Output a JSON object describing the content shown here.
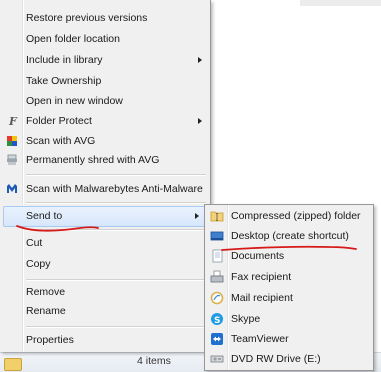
{
  "context_menu": {
    "items": [
      {
        "label": "Restore previous versions",
        "icon": null,
        "submenu": false
      },
      {
        "label": "Open folder location",
        "icon": null,
        "submenu": false
      },
      {
        "label": "Include in library",
        "icon": null,
        "submenu": true
      },
      {
        "label": "Take Ownership",
        "icon": null,
        "submenu": false
      },
      {
        "label": "Open in new window",
        "icon": null,
        "submenu": false
      },
      {
        "label": "Folder Protect",
        "icon": "folder-protect-icon",
        "submenu": true
      },
      {
        "label": "Scan with AVG",
        "icon": "avg-icon",
        "submenu": false
      },
      {
        "label": "Permanently shred with AVG",
        "icon": "shredder-icon",
        "submenu": false
      },
      {
        "label": "Scan with Malwarebytes Anti-Malware",
        "icon": "malwarebytes-icon",
        "submenu": false
      },
      {
        "label": "Send to",
        "icon": null,
        "submenu": true,
        "highlighted": true
      },
      {
        "label": "Cut",
        "icon": null,
        "submenu": false
      },
      {
        "label": "Copy",
        "icon": null,
        "submenu": false
      },
      {
        "label": "Remove",
        "icon": null,
        "submenu": false
      },
      {
        "label": "Rename",
        "icon": null,
        "submenu": false
      },
      {
        "label": "Properties",
        "icon": null,
        "submenu": false
      }
    ]
  },
  "send_to_menu": {
    "items": [
      {
        "label": "Compressed (zipped) folder",
        "icon": "zip-folder-icon"
      },
      {
        "label": "Desktop (create shortcut)",
        "icon": "desktop-icon"
      },
      {
        "label": "Documents",
        "icon": "documents-icon"
      },
      {
        "label": "Fax recipient",
        "icon": "fax-icon"
      },
      {
        "label": "Mail recipient",
        "icon": "mail-icon"
      },
      {
        "label": "Skype",
        "icon": "skype-icon"
      },
      {
        "label": "TeamViewer",
        "icon": "teamviewer-icon"
      },
      {
        "label": "DVD RW Drive (E:)",
        "icon": "dvd-drive-icon"
      }
    ]
  },
  "status_bar": {
    "item_count": "4 items"
  },
  "annotations": {
    "underline_color": "#d61a1a"
  }
}
